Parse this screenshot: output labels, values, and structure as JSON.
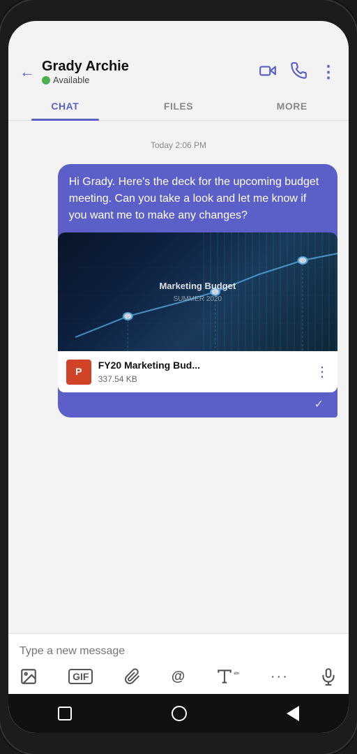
{
  "header": {
    "contact_name": "Grady Archie",
    "status": "Available",
    "back_label": "←"
  },
  "tabs": [
    {
      "label": "CHAT",
      "active": true
    },
    {
      "label": "FILES",
      "active": false
    },
    {
      "label": "MORE",
      "active": false
    }
  ],
  "chat": {
    "timestamp": "Today 2:06 PM",
    "message": "Hi Grady. Here's the deck for the upcoming budget meeting. Can you take a look and let me know if you want me to make any changes?",
    "attachment": {
      "preview_title": "Marketing Budget",
      "preview_subtitle": "SUMMER 2020",
      "file_name": "FY20 Marketing Bud...",
      "file_size": "337.54 KB",
      "ppt_label": "P"
    }
  },
  "input": {
    "placeholder": "Type a new message"
  },
  "toolbar": {
    "image_icon": "🖼",
    "gif_label": "GIF",
    "attach_icon": "📎",
    "mention_icon": "@",
    "format_icon": "A",
    "more_icon": "···",
    "mic_icon": "🎤"
  },
  "bottom_nav": {
    "square_label": "□",
    "circle_label": "○",
    "triangle_label": "◁"
  }
}
